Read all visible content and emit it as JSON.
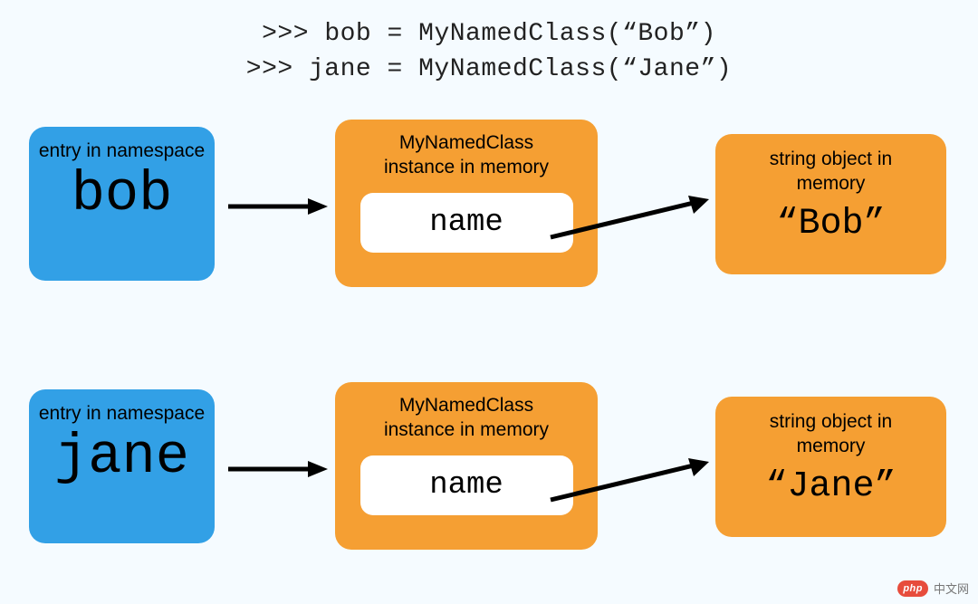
{
  "code": {
    "line1": ">>> bob = MyNamedClass(“Bob”)",
    "line2": ">>> jane = MyNamedClass(“Jane”)"
  },
  "rows": [
    {
      "ns_label": "entry in namespace",
      "ns_name": "bob",
      "mid_label_line1": "MyNamedClass",
      "mid_label_line2": "instance in memory",
      "inner": "name",
      "str_label_line1": "string object in",
      "str_label_line2": "memory",
      "str_value": "“Bob”"
    },
    {
      "ns_label": "entry in namespace",
      "ns_name": "jane",
      "mid_label_line1": "MyNamedClass",
      "mid_label_line2": "instance in memory",
      "inner": "name",
      "str_label_line1": "string object in",
      "str_label_line2": "memory",
      "str_value": "“Jane”"
    }
  ],
  "watermark": {
    "badge": "php",
    "text": "中文网"
  },
  "colors": {
    "bg": "#f5fbff",
    "blue": "#32a0e6",
    "orange": "#f59f33"
  },
  "chart_data": {
    "type": "diagram",
    "description": "Two Python REPL assignments create instances of MyNamedClass. Each namespace entry points to an instance in memory, whose 'name' attribute points to a string object.",
    "nodes": [
      {
        "id": "bob_ns",
        "kind": "namespace-entry",
        "value": "bob"
      },
      {
        "id": "bob_inst",
        "kind": "instance",
        "class": "MyNamedClass",
        "attrs": [
          "name"
        ]
      },
      {
        "id": "bob_str",
        "kind": "string-object",
        "value": "Bob"
      },
      {
        "id": "jane_ns",
        "kind": "namespace-entry",
        "value": "jane"
      },
      {
        "id": "jane_inst",
        "kind": "instance",
        "class": "MyNamedClass",
        "attrs": [
          "name"
        ]
      },
      {
        "id": "jane_str",
        "kind": "string-object",
        "value": "Jane"
      }
    ],
    "edges": [
      {
        "from": "bob_ns",
        "to": "bob_inst"
      },
      {
        "from": "bob_inst",
        "to": "bob_str",
        "via": "name"
      },
      {
        "from": "jane_ns",
        "to": "jane_inst"
      },
      {
        "from": "jane_inst",
        "to": "jane_str",
        "via": "name"
      }
    ]
  }
}
